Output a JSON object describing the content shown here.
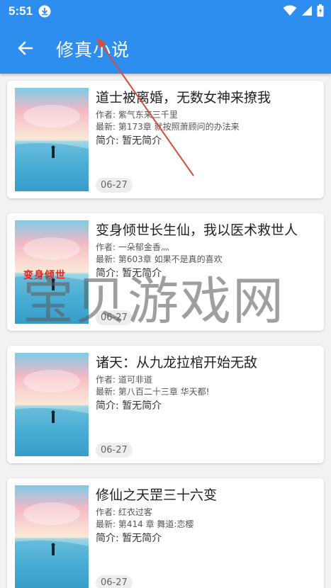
{
  "status_bar": {
    "time": "5:51",
    "icons": [
      "download-icon",
      "wifi-icon",
      "signal-icon",
      "battery-icon"
    ]
  },
  "app_bar": {
    "title": "修真小说",
    "back_icon": "arrow-left-icon"
  },
  "books": [
    {
      "title": "道士被离婚，无数女神来撩我",
      "author": "作者: 紫气东来三千里",
      "latest": "最新: 第173章 就按照萧顾问的办法来",
      "intro": "简介: 暂无简介",
      "date": "06-27"
    },
    {
      "title": "变身倾世长生仙，我以医术救世人",
      "author": "作者: 一朵郁金香灬",
      "latest": "最新: 第603章 如果不是真的喜欢",
      "intro": "简介: 暂无简介",
      "date": "06-27",
      "cover_text": "变身倾世"
    },
    {
      "title": "诸天：从九龙拉棺开始无敌",
      "author": "作者: 道可非道",
      "latest": "最新: 第八百二十三章 华天都!",
      "intro": "简介: 暂无简介",
      "date": "06-27"
    },
    {
      "title": "修仙之天罡三十六变",
      "author": "作者: 红衣过客",
      "latest": "最新: 第414 章 舞道:恋樱",
      "intro": "简介: 暂无简介",
      "date": "06-27"
    }
  ],
  "watermark": "宝贝游戏网",
  "colors": {
    "primary": "#2d8ef0",
    "background": "#f2f2f2",
    "card": "#ffffff",
    "annotation_arrow": "#d64d3a"
  }
}
